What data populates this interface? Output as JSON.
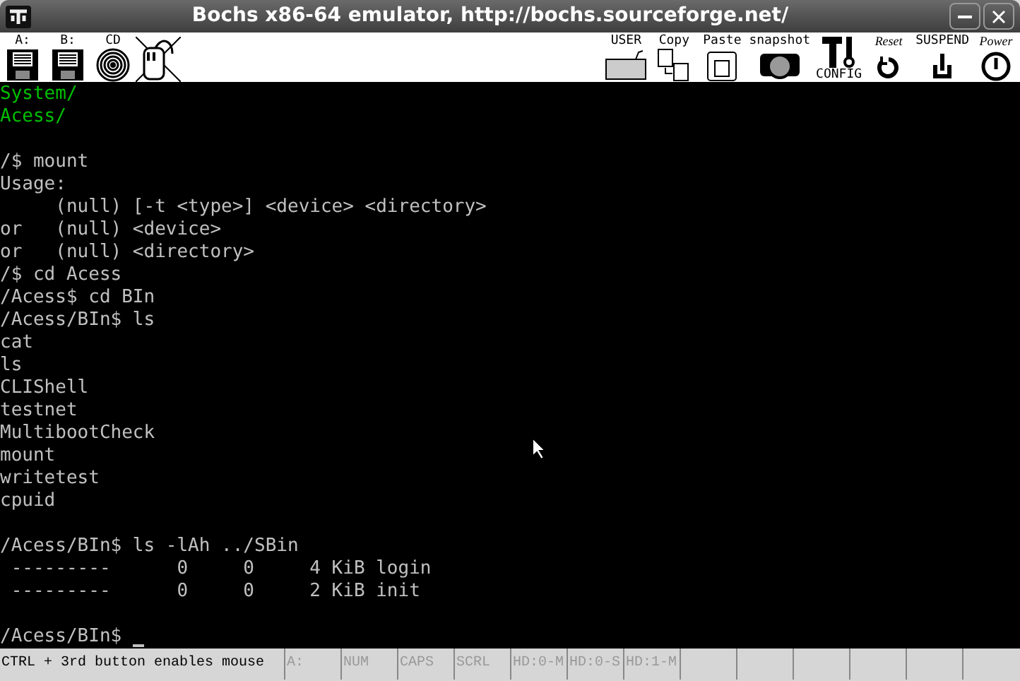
{
  "window": {
    "title": "Bochs x86-64 emulator, http://bochs.sourceforge.net/"
  },
  "toolbar": {
    "left": [
      {
        "kind": "floppy",
        "label": "A:"
      },
      {
        "kind": "floppy",
        "label": "B:"
      },
      {
        "kind": "cdrom",
        "label": "CD"
      },
      {
        "kind": "mouse"
      }
    ],
    "right": [
      {
        "kind": "keyboard",
        "label": "USER"
      },
      {
        "kind": "copy",
        "label": "Copy"
      },
      {
        "kind": "paste",
        "label": "Paste"
      },
      {
        "kind": "camera",
        "label": "snapshot"
      },
      {
        "kind": "config",
        "label": "CONFIG"
      },
      {
        "kind": "reset",
        "label": "Reset"
      },
      {
        "kind": "suspend",
        "label": "SUSPEND"
      },
      {
        "kind": "power",
        "label": "Power"
      }
    ]
  },
  "terminal": {
    "lines": [
      {
        "kind": "text",
        "text": "System/",
        "color": "#00c000"
      },
      {
        "kind": "text",
        "text": "Acess/",
        "color": "#00c000"
      },
      {
        "kind": "blank"
      },
      {
        "kind": "text",
        "text": "/$ mount",
        "color": "#c0c0c0"
      },
      {
        "kind": "text",
        "text": "Usage:",
        "color": "#c0c0c0"
      },
      {
        "kind": "text",
        "text": "     (null) [-t <type>] <device> <directory>",
        "color": "#c0c0c0"
      },
      {
        "kind": "text",
        "text": "or   (null) <device>",
        "color": "#c0c0c0"
      },
      {
        "kind": "text",
        "text": "or   (null) <directory>",
        "color": "#c0c0c0"
      },
      {
        "kind": "text",
        "text": "/$ cd Acess",
        "color": "#c0c0c0"
      },
      {
        "kind": "text",
        "text": "/Acess$ cd BIn",
        "color": "#c0c0c0"
      },
      {
        "kind": "text",
        "text": "/Acess/BIn$ ls",
        "color": "#c0c0c0"
      },
      {
        "kind": "text",
        "text": "cat",
        "color": "#c0c0c0"
      },
      {
        "kind": "text",
        "text": "ls",
        "color": "#c0c0c0"
      },
      {
        "kind": "text",
        "text": "CLIShell",
        "color": "#c0c0c0"
      },
      {
        "kind": "text",
        "text": "testnet",
        "color": "#c0c0c0"
      },
      {
        "kind": "text",
        "text": "MultibootCheck",
        "color": "#c0c0c0"
      },
      {
        "kind": "text",
        "text": "mount",
        "color": "#c0c0c0"
      },
      {
        "kind": "text",
        "text": "writetest",
        "color": "#c0c0c0"
      },
      {
        "kind": "text",
        "text": "cpuid",
        "color": "#c0c0c0"
      },
      {
        "kind": "blank"
      },
      {
        "kind": "text",
        "text": "/Acess/BIn$ ls -lAh ../SBin",
        "color": "#c0c0c0"
      },
      {
        "kind": "text",
        "text": " ---------      0     0     4 KiB login",
        "color": "#c0c0c0"
      },
      {
        "kind": "text",
        "text": " ---------      0     0     2 KiB init",
        "color": "#c0c0c0"
      },
      {
        "kind": "blank"
      },
      {
        "kind": "prompt",
        "text": "/Acess/BIn$ ",
        "color": "#c0c0c0"
      }
    ]
  },
  "status_bar": {
    "message": "CTRL + 3rd button enables mouse",
    "indicators": [
      {
        "label": "A:",
        "on": false
      },
      {
        "label": "NUM",
        "on": false
      },
      {
        "label": "CAPS",
        "on": false
      },
      {
        "label": "SCRL",
        "on": false
      },
      {
        "label": "HD:0-M",
        "on": false
      },
      {
        "label": "HD:0-S",
        "on": false
      },
      {
        "label": "HD:1-M",
        "on": false
      }
    ]
  }
}
